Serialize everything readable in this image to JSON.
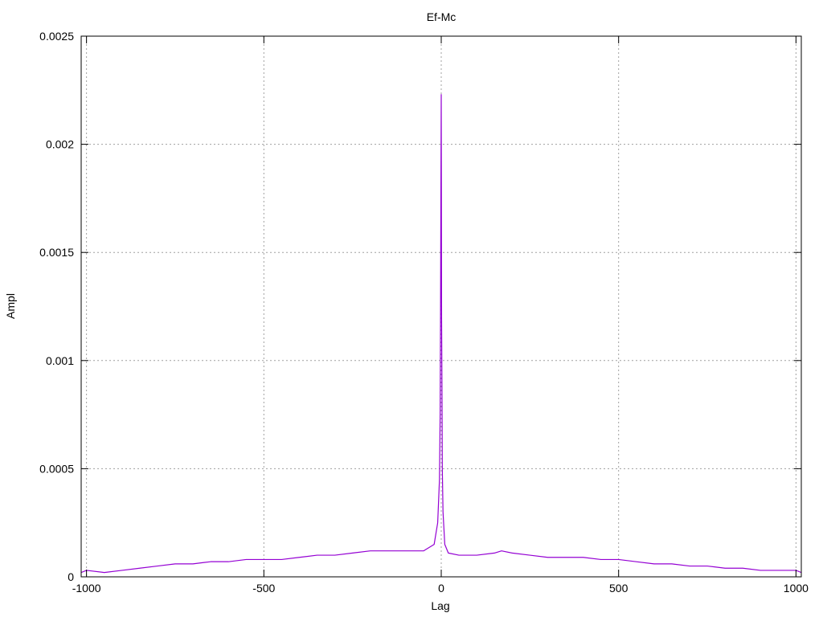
{
  "chart_data": {
    "type": "line",
    "title": "Ef-Mc",
    "xlabel": "Lag",
    "ylabel": "Ampl",
    "xlim": [
      -1015,
      1015
    ],
    "ylim": [
      0,
      0.0025
    ],
    "grid": true,
    "x_ticks": [
      -1000,
      -500,
      0,
      500,
      1000
    ],
    "x_tick_labels": [
      "-1000",
      "-500",
      "0",
      "500",
      "1000"
    ],
    "y_ticks": [
      0,
      0.0005,
      0.001,
      0.0015,
      0.002,
      0.0025
    ],
    "y_tick_labels": [
      "0",
      "0.0005",
      "0.001",
      "0.0015",
      "0.002",
      "0.0025"
    ],
    "series": [
      {
        "color": "#9400d3",
        "x": [
          -1015,
          -1000,
          -950,
          -900,
          -850,
          -800,
          -750,
          -700,
          -650,
          -600,
          -550,
          -500,
          -450,
          -400,
          -350,
          -300,
          -250,
          -200,
          -150,
          -100,
          -50,
          -20,
          -10,
          -5,
          -3,
          -2,
          -1,
          0,
          1,
          2,
          3,
          5,
          10,
          20,
          50,
          100,
          150,
          170,
          200,
          250,
          300,
          350,
          400,
          450,
          500,
          550,
          600,
          650,
          700,
          750,
          800,
          850,
          900,
          950,
          1000,
          1015
        ],
        "y": [
          2e-05,
          3e-05,
          2e-05,
          3e-05,
          4e-05,
          5e-05,
          6e-05,
          6e-05,
          7e-05,
          7e-05,
          8e-05,
          8e-05,
          8e-05,
          9e-05,
          0.0001,
          0.0001,
          0.00011,
          0.00012,
          0.00012,
          0.00012,
          0.00012,
          0.00015,
          0.00025,
          0.00045,
          0.00076,
          0.0012,
          0.00177,
          0.00223,
          0.0012,
          0.00089,
          0.0005,
          0.0003,
          0.00015,
          0.00011,
          0.0001,
          0.0001,
          0.00011,
          0.00012,
          0.00011,
          0.0001,
          9e-05,
          9e-05,
          9e-05,
          8e-05,
          8e-05,
          7e-05,
          6e-05,
          6e-05,
          5e-05,
          5e-05,
          4e-05,
          4e-05,
          3e-05,
          3e-05,
          3e-05,
          2e-05
        ]
      }
    ]
  }
}
